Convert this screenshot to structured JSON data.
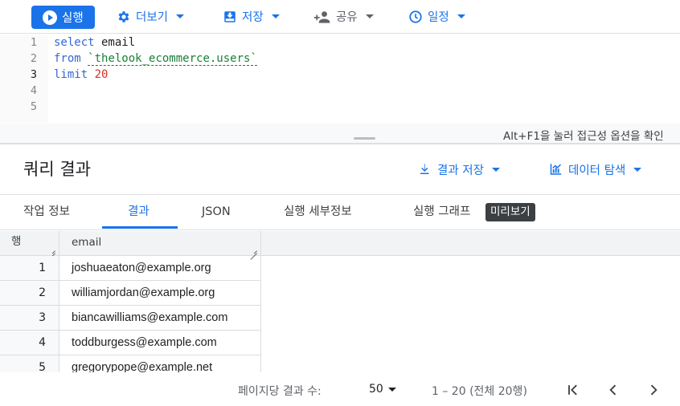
{
  "toolbar": {
    "run_label": "실행",
    "more_label": "더보기",
    "save_label": "저장",
    "share_label": "공유",
    "schedule_label": "일정"
  },
  "editor": {
    "line_numbers": [
      "1",
      "2",
      "3",
      "4",
      "5"
    ],
    "lines": [
      {
        "kw": "select",
        "rest": " email"
      },
      {
        "kw": "from",
        "str": "`thelook_ecommerce.users`"
      },
      {
        "kw": "limit",
        "num": "20"
      }
    ],
    "accessibility_hint": "Alt+F1을 눌러 접근성 옵션을 확인"
  },
  "results": {
    "title": "쿼리 결과",
    "save_results_label": "결과 저장",
    "explore_data_label": "데이터 탐색",
    "tabs": [
      {
        "label": "작업 정보"
      },
      {
        "label": "결과"
      },
      {
        "label": "JSON"
      },
      {
        "label": "실행 세부정보"
      },
      {
        "label": "실행 그래프"
      }
    ],
    "preview_badge": "미리보기",
    "table": {
      "col_row": "행",
      "col_email": "email",
      "rows": [
        {
          "n": "1",
          "email": "joshuaeaton@example.org"
        },
        {
          "n": "2",
          "email": "williamjordan@example.org"
        },
        {
          "n": "3",
          "email": "biancawilliams@example.com"
        },
        {
          "n": "4",
          "email": "toddburgess@example.com"
        },
        {
          "n": "5",
          "email": "gregorypope@example.net"
        }
      ]
    }
  },
  "pagination": {
    "page_size_label": "페이지당 결과 수:",
    "page_size": "50",
    "range": "1 – 20 (전체 20행)"
  },
  "colors": {
    "accent": "#1a73e8",
    "keyword": "#3367d6",
    "string": "#188038",
    "number": "#d93025"
  }
}
